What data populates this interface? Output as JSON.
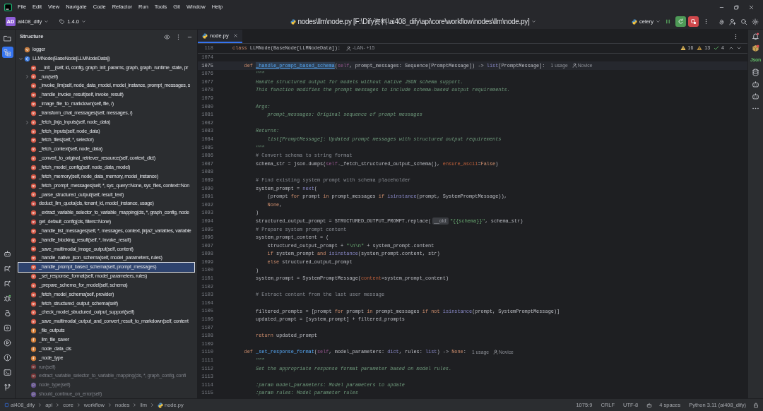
{
  "menu": [
    "File",
    "Edit",
    "View",
    "Navigate",
    "Code",
    "Refactor",
    "Run",
    "Tools",
    "Git",
    "Window",
    "Help"
  ],
  "toolbar": {
    "project_badge": "AD",
    "project": "ai408_dify",
    "version": "1.4.0",
    "file_path": "nodes\\llm\\node.py [F:\\Dify资料\\ai408_dify\\api\\core\\workflow\\nodes\\llm\\node.py]",
    "run_config": "celery"
  },
  "tool_strip": [
    {
      "selected": false
    },
    {
      "selected": true
    }
  ],
  "structure": {
    "title": "Structure",
    "items": [
      {
        "label": "logger",
        "kind": "variable",
        "selected": false
      },
      {
        "label": "LLMNode(BaseNode[LLMNodeData])",
        "kind": "class",
        "selected": false,
        "expanded": true,
        "children": [
          {
            "label": "__init__(self, id, config, graph_init_params, graph, graph_runtime_state, pr",
            "kind": "method",
            "selected": false
          },
          {
            "label": "_run(self)",
            "kind": "method",
            "selected": false,
            "expanded": false
          },
          {
            "label": "_invoke_llm(self, node_data_model, model_instance, prompt_messages, s",
            "kind": "method",
            "selected": false
          },
          {
            "label": "_handle_invoke_result(self, invoke_result)",
            "kind": "method",
            "selected": false
          },
          {
            "label": "_image_file_to_markdown(self, file, /)",
            "kind": "method",
            "selected": false
          },
          {
            "label": "_transform_chat_messages(self, messages, /)",
            "kind": "method",
            "selected": false
          },
          {
            "label": "_fetch_jinja_inputs(self, node_data)",
            "kind": "method",
            "selected": false,
            "expanded": false
          },
          {
            "label": "_fetch_inputs(self, node_data)",
            "kind": "method",
            "selected": false
          },
          {
            "label": "_fetch_files(self, *, selector)",
            "kind": "method",
            "selected": false
          },
          {
            "label": "_fetch_context(self, node_data)",
            "kind": "method",
            "selected": false
          },
          {
            "label": "_convert_to_original_retriever_resource(self, context_dict)",
            "kind": "method",
            "selected": false
          },
          {
            "label": "_fetch_model_config(self, node_data_model)",
            "kind": "method",
            "selected": false
          },
          {
            "label": "_fetch_memory(self, node_data_memory, model_instance)",
            "kind": "method",
            "selected": false
          },
          {
            "label": "_fetch_prompt_messages(self, *, sys_query=None, sys_files, context=Non",
            "kind": "method",
            "selected": false
          },
          {
            "label": "_parse_structured_output(self, result_text)",
            "kind": "method",
            "selected": false
          },
          {
            "label": "deduct_llm_quota(cls, tenant_id, model_instance, usage)",
            "kind": "static",
            "selected": false
          },
          {
            "label": "_extract_variable_selector_to_variable_mapping(cls, *, graph_config, node",
            "kind": "method",
            "selected": false
          },
          {
            "label": "get_default_config(cls, filters=None)",
            "kind": "static",
            "selected": false
          },
          {
            "label": "_handle_list_messages(self, *, messages, context, jinja2_variables, variable",
            "kind": "method",
            "selected": false
          },
          {
            "label": "_handle_blocking_result(self, *, invoke_result)",
            "kind": "method",
            "selected": false
          },
          {
            "label": "_save_multimodal_image_output(self, content)",
            "kind": "method",
            "selected": false
          },
          {
            "label": "_handle_native_json_schema(self, model_parameters, rules)",
            "kind": "method",
            "selected": false
          },
          {
            "label": "_handle_prompt_based_schema(self, prompt_messages)",
            "kind": "method",
            "selected": true
          },
          {
            "label": "_set_response_format(self, model_parameters, rules)",
            "kind": "method",
            "selected": false
          },
          {
            "label": "_prepare_schema_for_model(self, schema)",
            "kind": "method",
            "selected": false
          },
          {
            "label": "_fetch_model_schema(self, provider)",
            "kind": "method",
            "selected": false
          },
          {
            "label": "_fetch_structured_output_schema(self)",
            "kind": "method",
            "selected": false
          },
          {
            "label": "_check_model_structured_output_support(self)",
            "kind": "method",
            "selected": false
          },
          {
            "label": "_save_multimodal_output_and_convert_result_to_markdown(self, content",
            "kind": "method",
            "selected": false
          },
          {
            "label": "_file_outputs",
            "kind": "field",
            "selected": false
          },
          {
            "label": "_llm_file_saver",
            "kind": "field",
            "selected": false
          },
          {
            "label": "_node_data_cls",
            "kind": "field",
            "selected": false
          },
          {
            "label": "_node_type",
            "kind": "field",
            "selected": false
          },
          {
            "label": "run(self)",
            "kind": "inherited_method",
            "selected": false
          },
          {
            "label": "extract_variable_selector_to_variable_mapping(cls, *, graph_config, confi",
            "kind": "inherited_method",
            "selected": false
          },
          {
            "label": "node_type(self)",
            "kind": "inherited_property",
            "selected": false
          },
          {
            "label": "should_continue_on_error(self)",
            "kind": "inherited_property",
            "selected": false
          }
        ]
      }
    ]
  },
  "editor": {
    "tabs": [
      {
        "label": "node.py",
        "selected": true
      }
    ],
    "sticky_line": {
      "number": "118",
      "tokens": [
        {
          "kind": "kw",
          "text": "class "
        },
        {
          "kind": "p",
          "text": "LLMNode(BaseNode[LLMNodeData]):"
        }
      ],
      "hint": "-LAN- +15"
    },
    "inspections": {
      "warnings": "16",
      "weak_warnings": "13",
      "typos": "4"
    },
    "lines": [
      {
        "number": "1074",
        "current": false
      },
      {
        "number": "1075",
        "current": true,
        "tokens": [
          {
            "kind": "kw",
            "text": "    def "
          },
          {
            "kind": "fn_hl",
            "text": "_handle_prompt_based_schema"
          },
          {
            "kind": "p",
            "text": "("
          },
          {
            "kind": "self",
            "text": "self"
          },
          {
            "kind": "p",
            "text": ", prompt_messages: Sequence[PromptMessage]) -> "
          },
          {
            "kind": "builtin",
            "text": "list"
          },
          {
            "kind": "p",
            "text": "[PromptMessage]:"
          }
        ],
        "usage": "1 usage",
        "author": "Novice"
      },
      {
        "number": "1076",
        "current": false,
        "tokens": [
          {
            "kind": "doc",
            "text": "        \"\"\""
          }
        ]
      },
      {
        "number": "1077",
        "current": false,
        "tokens": [
          {
            "kind": "doc",
            "text": "        Handle structured output for models without native JSON schema support."
          }
        ]
      },
      {
        "number": "1078",
        "current": false,
        "tokens": [
          {
            "kind": "doc",
            "text": "        This function modifies the prompt messages to include schema-based output requirements."
          }
        ]
      },
      {
        "number": "1079",
        "current": false
      },
      {
        "number": "1080",
        "current": false,
        "tokens": [
          {
            "kind": "doc",
            "text": "        Args:"
          }
        ]
      },
      {
        "number": "1081",
        "current": false,
        "tokens": [
          {
            "kind": "doc",
            "text": "            prompt_messages: Original sequence of prompt messages"
          }
        ]
      },
      {
        "number": "1082",
        "current": false
      },
      {
        "number": "1083",
        "current": false,
        "tokens": [
          {
            "kind": "doc",
            "text": "        Returns:"
          }
        ]
      },
      {
        "number": "1084",
        "current": false,
        "tokens": [
          {
            "kind": "doc",
            "text": "            list[PromptMessage]: Updated prompt messages with structured output requirements"
          }
        ]
      },
      {
        "number": "1085",
        "current": false,
        "tokens": [
          {
            "kind": "doc",
            "text": "        \"\"\""
          }
        ]
      },
      {
        "number": "1086",
        "current": false,
        "tokens": [
          {
            "kind": "cmt",
            "text": "        # Convert schema to string format"
          }
        ]
      },
      {
        "number": "1087",
        "current": false,
        "tokens": [
          {
            "kind": "p",
            "text": "        schema_str = json.dumps("
          },
          {
            "kind": "self",
            "text": "self"
          },
          {
            "kind": "p",
            "text": "._fetch_structured_output_schema(), "
          },
          {
            "kind": "param",
            "text": "ensure_ascii"
          },
          {
            "kind": "p",
            "text": "="
          },
          {
            "kind": "kw",
            "text": "False"
          },
          {
            "kind": "p",
            "text": ")"
          }
        ]
      },
      {
        "number": "1088",
        "current": false
      },
      {
        "number": "1089",
        "current": false,
        "tokens": [
          {
            "kind": "cmt",
            "text": "        # Find existing system prompt with schema placeholder"
          }
        ]
      },
      {
        "number": "1090",
        "current": false,
        "tokens": [
          {
            "kind": "p",
            "text": "        system_prompt = "
          },
          {
            "kind": "builtin",
            "text": "next"
          },
          {
            "kind": "p",
            "text": "("
          }
        ]
      },
      {
        "number": "1091",
        "current": false,
        "tokens": [
          {
            "kind": "p",
            "text": "            (prompt "
          },
          {
            "kind": "kw",
            "text": "for"
          },
          {
            "kind": "p",
            "text": " prompt "
          },
          {
            "kind": "kw",
            "text": "in"
          },
          {
            "kind": "p",
            "text": " prompt_messages "
          },
          {
            "kind": "kw",
            "text": "if "
          },
          {
            "kind": "builtin",
            "text": "isinstance"
          },
          {
            "kind": "p",
            "text": "(prompt, SystemPromptMessage)),"
          }
        ]
      },
      {
        "number": "1092",
        "current": false,
        "tokens": [
          {
            "kind": "kw",
            "text": "            None"
          },
          {
            "kind": "p",
            "text": ","
          }
        ]
      },
      {
        "number": "1093",
        "current": false,
        "tokens": [
          {
            "kind": "p",
            "text": "        )"
          }
        ]
      },
      {
        "number": "1094",
        "current": false,
        "tokens": [
          {
            "kind": "p",
            "text": "        structured_output_prompt = STRUCTURED_OUTPUT_PROMPT.replace("
          },
          {
            "kind": "inlay",
            "text": "__old:"
          },
          {
            "kind": "str",
            "text": "\"{{schema}}\""
          },
          {
            "kind": "p",
            "text": ", schema_str)"
          }
        ]
      },
      {
        "number": "1095",
        "current": false,
        "tokens": [
          {
            "kind": "cmt",
            "text": "        # Prepare system prompt content"
          }
        ]
      },
      {
        "number": "1096",
        "current": false,
        "tokens": [
          {
            "kind": "p",
            "text": "        system_prompt_content = ("
          }
        ]
      },
      {
        "number": "1097",
        "current": false,
        "tokens": [
          {
            "kind": "p",
            "text": "            structured_output_prompt + "
          },
          {
            "kind": "str",
            "text": "\"\\n\\n\""
          },
          {
            "kind": "p",
            "text": " + system_prompt.content"
          }
        ]
      },
      {
        "number": "1098",
        "current": false,
        "tokens": [
          {
            "kind": "kw",
            "text": "            if"
          },
          {
            "kind": "p",
            "text": " system_prompt "
          },
          {
            "kind": "kw",
            "text": "and "
          },
          {
            "kind": "builtin",
            "text": "isinstance"
          },
          {
            "kind": "p",
            "text": "(system_prompt.content, str)"
          }
        ]
      },
      {
        "number": "1099",
        "current": false,
        "tokens": [
          {
            "kind": "kw",
            "text": "            else"
          },
          {
            "kind": "p",
            "text": " structured_output_prompt"
          }
        ]
      },
      {
        "number": "1100",
        "current": false,
        "tokens": [
          {
            "kind": "p",
            "text": "        )"
          }
        ]
      },
      {
        "number": "1101",
        "current": false,
        "tokens": [
          {
            "kind": "p",
            "text": "        system_prompt = SystemPromptMessage("
          },
          {
            "kind": "param",
            "text": "content"
          },
          {
            "kind": "p",
            "text": "=system_prompt_content)"
          }
        ]
      },
      {
        "number": "1102",
        "current": false
      },
      {
        "number": "1103",
        "current": false,
        "tokens": [
          {
            "kind": "cmt",
            "text": "        # Extract content from the last user message"
          }
        ]
      },
      {
        "number": "1104",
        "current": false
      },
      {
        "number": "1105",
        "current": false,
        "tokens": [
          {
            "kind": "p",
            "text": "        filtered_prompts = [prompt "
          },
          {
            "kind": "kw",
            "text": "for"
          },
          {
            "kind": "p",
            "text": " prompt "
          },
          {
            "kind": "kw",
            "text": "in"
          },
          {
            "kind": "p",
            "text": " prompt_messages "
          },
          {
            "kind": "kw",
            "text": "if not "
          },
          {
            "kind": "builtin",
            "text": "isinstance"
          },
          {
            "kind": "p",
            "text": "(prompt, SystemPromptMessage)]"
          }
        ]
      },
      {
        "number": "1106",
        "current": false,
        "tokens": [
          {
            "kind": "p",
            "text": "        updated_prompt = [system_prompt] + filtered_prompts"
          }
        ]
      },
      {
        "number": "1107",
        "current": false
      },
      {
        "number": "1108",
        "current": false,
        "tokens": [
          {
            "kind": "kw",
            "text": "        return"
          },
          {
            "kind": "p",
            "text": " updated_prompt"
          }
        ]
      },
      {
        "number": "1109",
        "current": false
      },
      {
        "number": "1110",
        "current": false,
        "tokens": [
          {
            "kind": "kw",
            "text": "    def "
          },
          {
            "kind": "fn",
            "text": "_set_response_format"
          },
          {
            "kind": "p",
            "text": "("
          },
          {
            "kind": "self",
            "text": "self"
          },
          {
            "kind": "p",
            "text": ", model_parameters: "
          },
          {
            "kind": "builtin",
            "text": "dict"
          },
          {
            "kind": "p",
            "text": ", rules: "
          },
          {
            "kind": "builtin",
            "text": "list"
          },
          {
            "kind": "p",
            "text": ") -> "
          },
          {
            "kind": "kw",
            "text": "None"
          },
          {
            "kind": "p",
            "text": ":"
          }
        ],
        "usage": "1 usage",
        "author": "Novice"
      },
      {
        "number": "1111",
        "current": false,
        "tokens": [
          {
            "kind": "doc",
            "text": "        \"\"\""
          }
        ]
      },
      {
        "number": "1112",
        "current": false,
        "tokens": [
          {
            "kind": "doc",
            "text": "        Set the appropriate response format parameter based on model rules."
          }
        ]
      },
      {
        "number": "1113",
        "current": false
      },
      {
        "number": "1114",
        "current": false,
        "tokens": [
          {
            "kind": "doc",
            "text": "        :param model_parameters: Model parameters to update"
          }
        ]
      },
      {
        "number": "1115",
        "current": false,
        "tokens": [
          {
            "kind": "doc",
            "text": "        :param rules: Model parameter rules"
          }
        ]
      }
    ]
  },
  "right_strip_label": "Json",
  "status_bar": {
    "breadcrumbs": [
      "ai408_dify",
      "api",
      "core",
      "workflow",
      "nodes",
      "llm",
      "node.py"
    ],
    "position": "1075:9",
    "line_separator": "CRLF",
    "encoding": "UTF-8",
    "indent": "4 spaces",
    "interpreter": "Python 3.11 (ai408_dify)"
  }
}
